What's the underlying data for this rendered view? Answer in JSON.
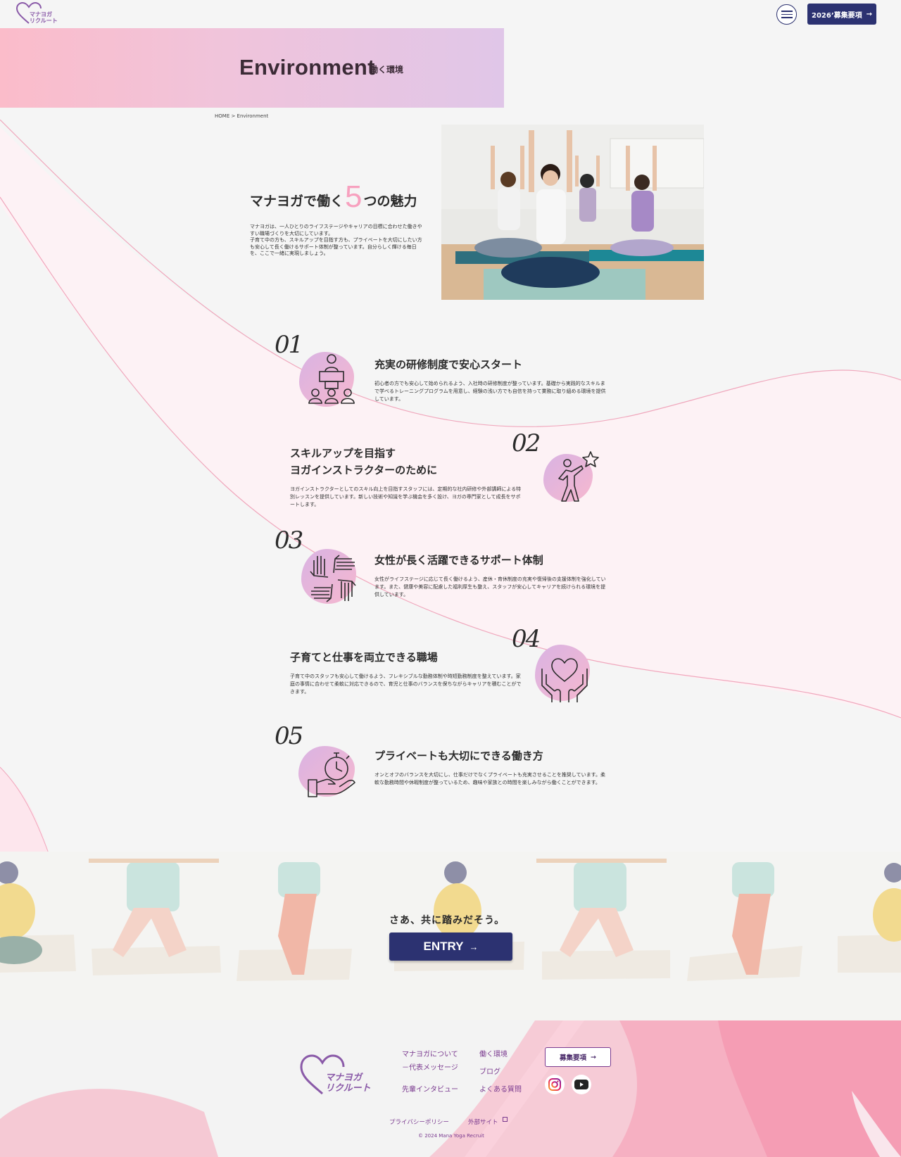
{
  "header": {
    "logo_text": "マナヨガ\nリクルート",
    "recruit_button": "2026’募集要項",
    "recruit_arrow": "→"
  },
  "hero": {
    "title": "Environment",
    "subtitle": "働く環境"
  },
  "breadcrumb": "HOME > Environment",
  "intro": {
    "heading_before": "マナヨガで働く",
    "heading_number": "5",
    "heading_after": "つの魅力",
    "body": "マナヨガは、一人ひとりのライフステージやキャリアの目標に合わせた働きやすい職場づくりを大切にしています。\n子育て中の方も、スキルアップを目指す方も、プライベートを大切にしたい方も安心して長く働けるサポート体制が整っています。自分らしく輝ける毎日を、ここで一緒に実現しましょう。"
  },
  "features": [
    {
      "number": "01",
      "icon": "training-seminar-icon",
      "title": "充実の研修制度で安心スタート",
      "text": "初心者の方でも安心して始められるよう、入社時の研修制度が整っています。基礎から実践的なスキルまで学べるトレーニングプログラムを用意し、経験の浅い方でも自信を持って業務に取り組める環境を提供しています。"
    },
    {
      "number": "02",
      "icon": "person-reaching-star-icon",
      "title": "スキルアップを目指す\nヨガインストラクターのために",
      "text": "ヨガインストラクターとしてのスキル向上を目指すスタッフには、定期的な社内研修や外部講師による特別レッスンを提供しています。新しい技術や知識を学ぶ機会を多く設け、ヨガの専門家として成長をサポートします。"
    },
    {
      "number": "03",
      "icon": "hands-together-icon",
      "title": "女性が長く活躍できるサポート体制",
      "text": "女性がライフステージに応じて長く働けるよう、産休・育休制度の充実や復帰後の支援体制を強化しています。また、健康や美容に配慮した福利厚生も整え、スタッフが安心してキャリアを続けられる環境を提供しています。"
    },
    {
      "number": "04",
      "icon": "heart-in-hands-icon",
      "title": "子育てと仕事を両立できる職場",
      "text": "子育て中のスタッフも安心して働けるよう、フレキシブルな勤務体制や時短勤務制度を整えています。家庭の事情に合わせて柔軟に対応できるので、育児と仕事のバランスを保ちながらキャリアを積むことができます。"
    },
    {
      "number": "05",
      "icon": "stopwatch-hand-icon",
      "title": "プライベートも大切にできる働き方",
      "text": "オンとオフのバランスを大切にし、仕事だけでなくプライベートも充実させることを推奨しています。柔軟な勤務時間や休暇制度が整っているため、趣味や家族との時間を楽しみながら働くことができます。"
    }
  ],
  "entry": {
    "catch": "さあ、共に踏みだそう。",
    "button": "ENTRY",
    "arrow": "→"
  },
  "footer": {
    "logo_text": "マナヨガ\nリクルート",
    "links": {
      "about": "マナヨガについて",
      "message": "－代表メッセージ",
      "interview": "先輩インタビュー",
      "environment": "働く環境",
      "blog": "ブログ",
      "faq": "よくある質問"
    },
    "recruit_button": "募集要項",
    "recruit_arrow": "→",
    "privacy": "プライバシーポリシー",
    "external": "外部サイト",
    "copyright": "© 2024 Mana Yoga Recruit"
  },
  "colors": {
    "navy": "#2c3271",
    "pink": "#f7a1bf",
    "purple": "#7a3a8f",
    "hero_gradient_start": "#fbbcca",
    "hero_gradient_end": "#e0c6e8"
  }
}
